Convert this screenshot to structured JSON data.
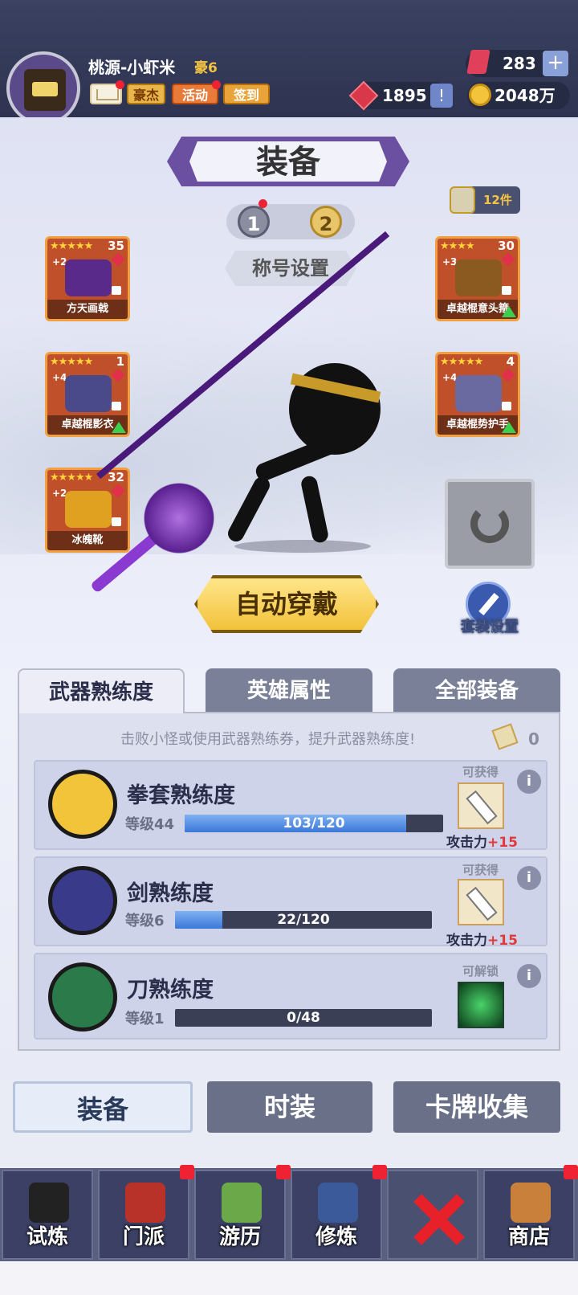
{
  "player": {
    "name": "桃源-小虾米",
    "vip": "豪6"
  },
  "header_buttons": {
    "hero": "豪杰",
    "activity": "活动",
    "signin": "签到"
  },
  "currency": {
    "gems": "283",
    "rubies": "1895",
    "coins": "2048万",
    "plus": "+",
    "alert": "!"
  },
  "page": {
    "title": "装备",
    "title_setting": "称号设置",
    "scroll_count": "12件",
    "pages": [
      "1",
      "2"
    ]
  },
  "equipment": [
    {
      "name": "方天画戟",
      "stars": "★★★★★",
      "count": "35",
      "level": "+2",
      "art_color": "#5a2a8a"
    },
    {
      "name": "卓越棍影衣",
      "stars": "★★★★★",
      "count": "1",
      "level": "+4",
      "art_color": "#4a4a8a"
    },
    {
      "name": "冰魄靴",
      "stars": "★★★★★",
      "count": "32",
      "level": "+2",
      "art_color": "#e0a020"
    },
    {
      "name": "卓越棍意头箍",
      "stars": "★★★★",
      "count": "30",
      "level": "+3",
      "art_color": "#8a5a20"
    },
    {
      "name": "卓越棍势护手",
      "stars": "★★★★★",
      "count": "4",
      "level": "+4",
      "art_color": "#6a6aa0"
    }
  ],
  "actions": {
    "auto_equip": "自动穿戴",
    "suit_setting": "套装设置"
  },
  "tabs": [
    "武器熟练度",
    "英雄属性",
    "全部装备"
  ],
  "proficiency": {
    "hint": "击败小怪或使用武器熟练券，提升武器熟练度!",
    "ticket_count": "0",
    "rows": [
      {
        "name": "拳套熟练度",
        "level": "等级44",
        "progress": "103/120",
        "fraction": 0.858,
        "status": "可获得",
        "reward_label": "攻击力",
        "reward_value": "+15"
      },
      {
        "name": "剑熟练度",
        "level": "等级6",
        "progress": "22/120",
        "fraction": 0.183,
        "status": "可获得",
        "reward_label": "攻击力",
        "reward_value": "+15"
      },
      {
        "name": "刀熟练度",
        "level": "等级1",
        "progress": "0/48",
        "fraction": 0,
        "status": "可解锁"
      }
    ]
  },
  "sub_tabs": [
    "装备",
    "时装",
    "卡牌收集"
  ],
  "nav": [
    "试炼",
    "门派",
    "游历",
    "修炼",
    "",
    "商店"
  ],
  "colors": {
    "accent": "#6b4fa0",
    "gold": "#f2c23a",
    "alert_red": "#ee2233"
  }
}
